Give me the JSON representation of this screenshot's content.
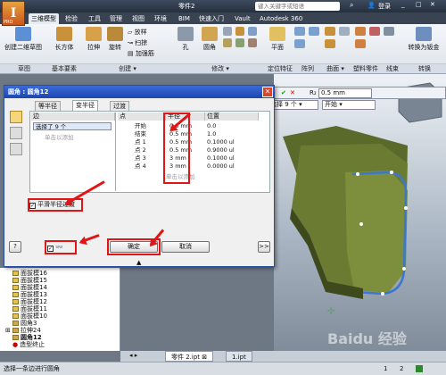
{
  "app": {
    "doc_title": "零件2",
    "search_placeholder": "键入关键字或短语",
    "login": "登录",
    "logo_letter": "I",
    "logo_sub": "PRO"
  },
  "tabs": [
    "三维模型",
    "检验",
    "工具",
    "管理",
    "视图",
    "环境",
    "BIM",
    "快速入门",
    "Vault",
    "Autodesk 360"
  ],
  "ribbon": {
    "buttons": [
      "创建二维草图",
      "长方体",
      "拉伸",
      "旋转",
      "放样",
      "扫掠",
      "加强筋",
      "孔",
      "圆角",
      "平面",
      "转换为钣金"
    ],
    "groups": [
      "草图",
      "基本要素",
      "创建 ▾",
      "修改 ▾",
      "定位特征",
      "阵列",
      "曲面 ▾",
      "塑料零件",
      "线束",
      "转换"
    ]
  },
  "propbar": {
    "radius_label": "R₂",
    "radius_value": "0.5 mm",
    "selected": "已选择 9 个",
    "mode": "开始"
  },
  "dialog": {
    "title": "圆角 : 圆角12",
    "tabs": [
      "等半径",
      "变半径",
      "过渡"
    ],
    "panel": {
      "col_edge": "边",
      "select_label": "选择了 9 个",
      "add_hint": "单击以添加",
      "col_point": "点",
      "col_radius": "半径",
      "col_position": "位置",
      "rows": [
        {
          "point": "开始",
          "radius": "0.5 mm",
          "position": "0.0"
        },
        {
          "point": "结束",
          "radius": "0.5 mm",
          "position": "1.0"
        },
        {
          "point": "点 1",
          "radius": "0.5 mm",
          "position": "0.1000 ul"
        },
        {
          "point": "点 2",
          "radius": "0.5 mm",
          "position": "0.9000 ul"
        },
        {
          "point": "点 3",
          "radius": "3 mm",
          "position": "0.1000 ul"
        },
        {
          "point": "点 4",
          "radius": "3 mm",
          "position": "0.0000 ul"
        }
      ],
      "add_hint2": "单击以添加"
    },
    "smooth_label": "平滑半径过渡",
    "ok": "确定",
    "cancel": "取消",
    "more": ">>",
    "help": "?"
  },
  "browser": {
    "items": [
      "面拔模16",
      "面拔模15",
      "面拔模14",
      "面拔模13",
      "面拔模12",
      "面拔模11",
      "面拔模10",
      "圆角3",
      "拉伸24",
      "圆角12",
      "造型终止"
    ]
  },
  "doc_tabs": [
    "零件 2.ipt",
    "1.ipt"
  ],
  "status": {
    "text": "选择一条边进行圆角",
    "page1": "1",
    "page2": "2"
  },
  "watermark": "Baidu 经验"
}
